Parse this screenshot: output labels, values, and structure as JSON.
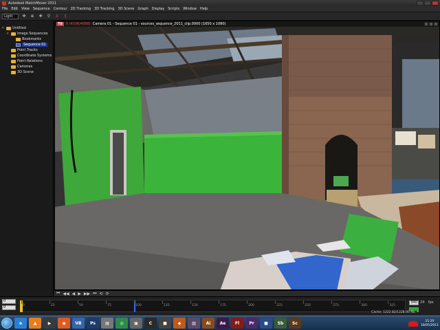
{
  "window": {
    "title": "Autodesk MatchMover 2011"
  },
  "menu": [
    "File",
    "Edit",
    "View",
    "Sequence",
    "Contour",
    "2D Tracking",
    "3D Tracking",
    "3D Scene",
    "Graph",
    "Display",
    "Scripts",
    "Window",
    "Help"
  ],
  "toolbar": {
    "mode_value": "Light",
    "icons": [
      "move-icon",
      "zoom-icon",
      "tracker-icon",
      "link-icon",
      "anchor-icon",
      "key-icon"
    ]
  },
  "tree": {
    "items": [
      {
        "label": "Untitled",
        "level": 0,
        "kind": "root"
      },
      {
        "label": "Image Sequences",
        "level": 1,
        "kind": "folder"
      },
      {
        "label": "Bookmarks",
        "level": 2,
        "kind": "bookmark"
      },
      {
        "label": "Sequence 01",
        "level": 2,
        "kind": "sequence",
        "selected": true
      },
      {
        "label": "Point Tracks",
        "level": 1,
        "kind": "folder"
      },
      {
        "label": "Coordinate Systems",
        "level": 1,
        "kind": "folder"
      },
      {
        "label": "Point Relations",
        "level": 1,
        "kind": "folder"
      },
      {
        "label": "Cameras",
        "level": 1,
        "kind": "folder"
      },
      {
        "label": "3D Scene",
        "level": 1,
        "kind": "folder"
      }
    ]
  },
  "viewport": {
    "badge": "T0",
    "frame_info": "0 (4106/4068)",
    "camera": "Camera 01 - Sequence 01 - sources_sequence_2011_clip.0000 (1650 x 1080)"
  },
  "transport": {
    "buttons": [
      "⏮",
      "◀◀",
      "◀",
      "▶",
      "▶▶",
      "⏭",
      "⟲",
      "⟳"
    ]
  },
  "timeline": {
    "start_field": "0",
    "start_field2": "0",
    "ticks": [
      0,
      25,
      50,
      75,
      100,
      125,
      150,
      175,
      200,
      225,
      250,
      275,
      300,
      325
    ],
    "range_end": 340,
    "current_frame": 100,
    "end_field": "340",
    "fps_label": "fps",
    "fps_value": "24"
  },
  "status": {
    "cache": "Cache: 1222.82/1228.00 Mb",
    "time": "11:20",
    "date": "18/05/2011"
  },
  "taskbar": {
    "apps": [
      {
        "name": "ie-icon",
        "label": "e",
        "color": "#2a7fd4"
      },
      {
        "name": "vlc-icon",
        "label": "▲",
        "color": "#e87d1e"
      },
      {
        "name": "media-icon",
        "label": "▶",
        "color": "#3a3a3a"
      },
      {
        "name": "firefox-icon",
        "label": "◉",
        "color": "#e05a1a"
      },
      {
        "name": "app-vb-icon",
        "label": "VB",
        "color": "#3666a8"
      },
      {
        "name": "photoshop-icon",
        "label": "Ps",
        "color": "#1c3a6a"
      },
      {
        "name": "app-grey-icon",
        "label": "▤",
        "color": "#777"
      },
      {
        "name": "app-green-icon",
        "label": "◎",
        "color": "#2e8a4a"
      },
      {
        "name": "app-monitor-icon",
        "label": "▣",
        "color": "#666"
      },
      {
        "name": "app-c4d-icon",
        "label": "C",
        "color": "#2a2a2a"
      },
      {
        "name": "app-dark-icon",
        "label": "■",
        "color": "#444"
      },
      {
        "name": "app-orange-icon",
        "label": "◆",
        "color": "#c05a1a"
      },
      {
        "name": "app-photo-icon",
        "label": "▥",
        "color": "#5a4a6a"
      },
      {
        "name": "illustrator-icon",
        "label": "Ai",
        "color": "#8a4a1a"
      },
      {
        "name": "app-ae-icon",
        "label": "Ae",
        "color": "#3a1a4a"
      },
      {
        "name": "flash-icon",
        "label": "Fl",
        "color": "#8a1a1a"
      },
      {
        "name": "app-pr-icon",
        "label": "Pr",
        "color": "#4a2a6a"
      },
      {
        "name": "app-blue-icon",
        "label": "■",
        "color": "#2a4a8a"
      },
      {
        "name": "soundbooth-icon",
        "label": "Sb",
        "color": "#3a5a3a"
      },
      {
        "name": "app-sc-icon",
        "label": "Sc",
        "color": "#5a3a1a"
      }
    ]
  }
}
